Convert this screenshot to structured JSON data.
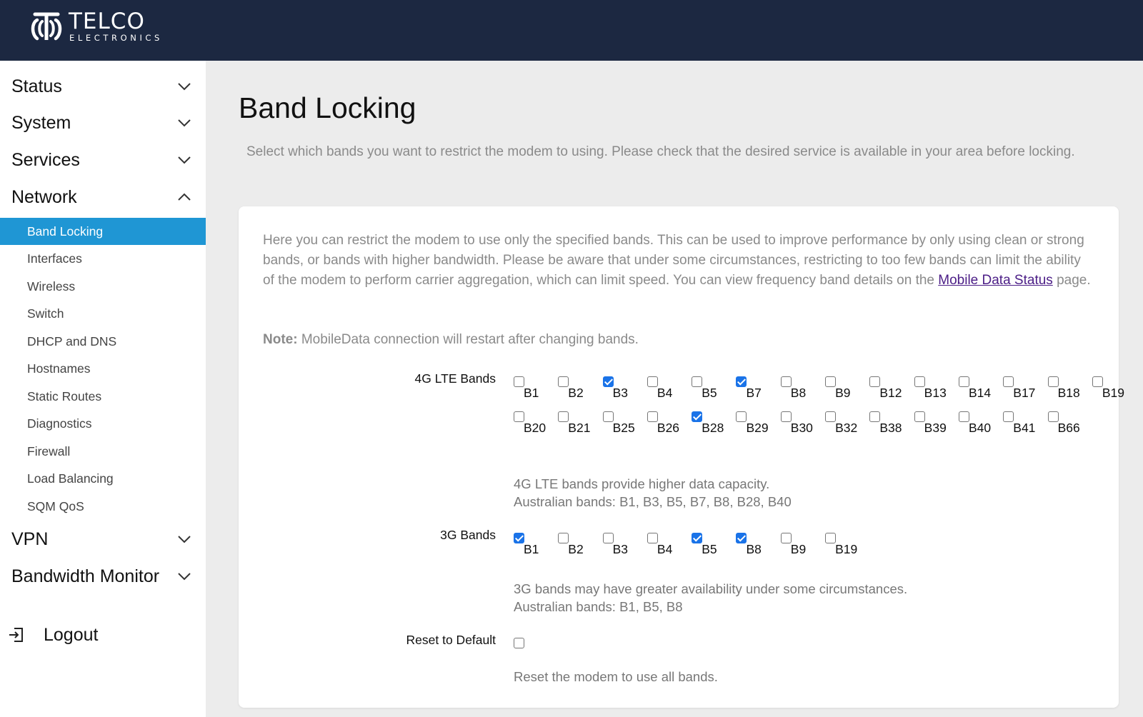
{
  "brand": {
    "title": "TELCO",
    "subtitle": "ELECTRONICS"
  },
  "sidebar": {
    "groups": [
      {
        "label": "Status",
        "expanded": false
      },
      {
        "label": "System",
        "expanded": false
      },
      {
        "label": "Services",
        "expanded": false
      },
      {
        "label": "Network",
        "expanded": true
      },
      {
        "label": "VPN",
        "expanded": false
      },
      {
        "label": "Bandwidth Monitor",
        "expanded": false
      }
    ],
    "network_items": [
      {
        "label": "Band Locking",
        "active": true
      },
      {
        "label": "Interfaces"
      },
      {
        "label": "Wireless"
      },
      {
        "label": "Switch"
      },
      {
        "label": "DHCP and DNS"
      },
      {
        "label": "Hostnames"
      },
      {
        "label": "Static Routes"
      },
      {
        "label": "Diagnostics"
      },
      {
        "label": "Firewall"
      },
      {
        "label": "Load Balancing"
      },
      {
        "label": "SQM QoS"
      }
    ],
    "logout_label": "Logout"
  },
  "main": {
    "title": "Band Locking",
    "description": "Select which bands you want to restrict the modem to using. Please check that the desired service is available in your area before locking.",
    "intro_before_link": "Here you can restrict the modem to use only the specified bands. This can be used to improve performance by only using clean or strong bands, or bands with higher bandwidth. Please be aware that under some circumstances, restricting to too few bands can limit the ability of the modem to perform carrier aggregation, which can limit speed. You can view frequency band details on the ",
    "intro_link": "Mobile Data Status",
    "intro_after_link": " page.",
    "note_label": "Note:",
    "note_text": " MobileData connection will restart after changing bands.",
    "lte": {
      "label": "4G LTE Bands",
      "rows": [
        [
          {
            "name": "B1",
            "checked": false
          },
          {
            "name": "B2",
            "checked": false
          },
          {
            "name": "B3",
            "checked": true
          },
          {
            "name": "B4",
            "checked": false
          },
          {
            "name": "B5",
            "checked": false
          },
          {
            "name": "B7",
            "checked": true
          },
          {
            "name": "B8",
            "checked": false
          },
          {
            "name": "B9",
            "checked": false
          },
          {
            "name": "B12",
            "checked": false
          },
          {
            "name": "B13",
            "checked": false
          },
          {
            "name": "B14",
            "checked": false
          },
          {
            "name": "B17",
            "checked": false
          },
          {
            "name": "B18",
            "checked": false
          },
          {
            "name": "B19",
            "checked": false
          }
        ],
        [
          {
            "name": "B20",
            "checked": false
          },
          {
            "name": "B21",
            "checked": false
          },
          {
            "name": "B25",
            "checked": false
          },
          {
            "name": "B26",
            "checked": false
          },
          {
            "name": "B28",
            "checked": true
          },
          {
            "name": "B29",
            "checked": false
          },
          {
            "name": "B30",
            "checked": false
          },
          {
            "name": "B32",
            "checked": false
          },
          {
            "name": "B38",
            "checked": false
          },
          {
            "name": "B39",
            "checked": false
          },
          {
            "name": "B40",
            "checked": false
          },
          {
            "name": "B41",
            "checked": false
          },
          {
            "name": "B66",
            "checked": false
          }
        ]
      ],
      "hint1": "4G LTE bands provide higher data capacity.",
      "hint2": "Australian bands: B1, B3, B5, B7, B8, B28, B40"
    },
    "g3": {
      "label": "3G Bands",
      "bands": [
        {
          "name": "B1",
          "checked": true
        },
        {
          "name": "B2",
          "checked": false
        },
        {
          "name": "B3",
          "checked": false
        },
        {
          "name": "B4",
          "checked": false
        },
        {
          "name": "B5",
          "checked": true
        },
        {
          "name": "B8",
          "checked": true
        },
        {
          "name": "B9",
          "checked": false
        },
        {
          "name": "B19",
          "checked": false
        }
      ],
      "hint1": "3G bands may have greater availability under some circumstances.",
      "hint2": "Australian bands: B1, B5, B8"
    },
    "reset": {
      "label": "Reset to Default",
      "checked": false,
      "hint": "Reset the modem to use all bands."
    }
  },
  "colors": {
    "header_bg": "#1c2841",
    "active_nav": "#1f96d4",
    "checkbox_checked": "#1a73e8",
    "link": "#4b1d86"
  }
}
